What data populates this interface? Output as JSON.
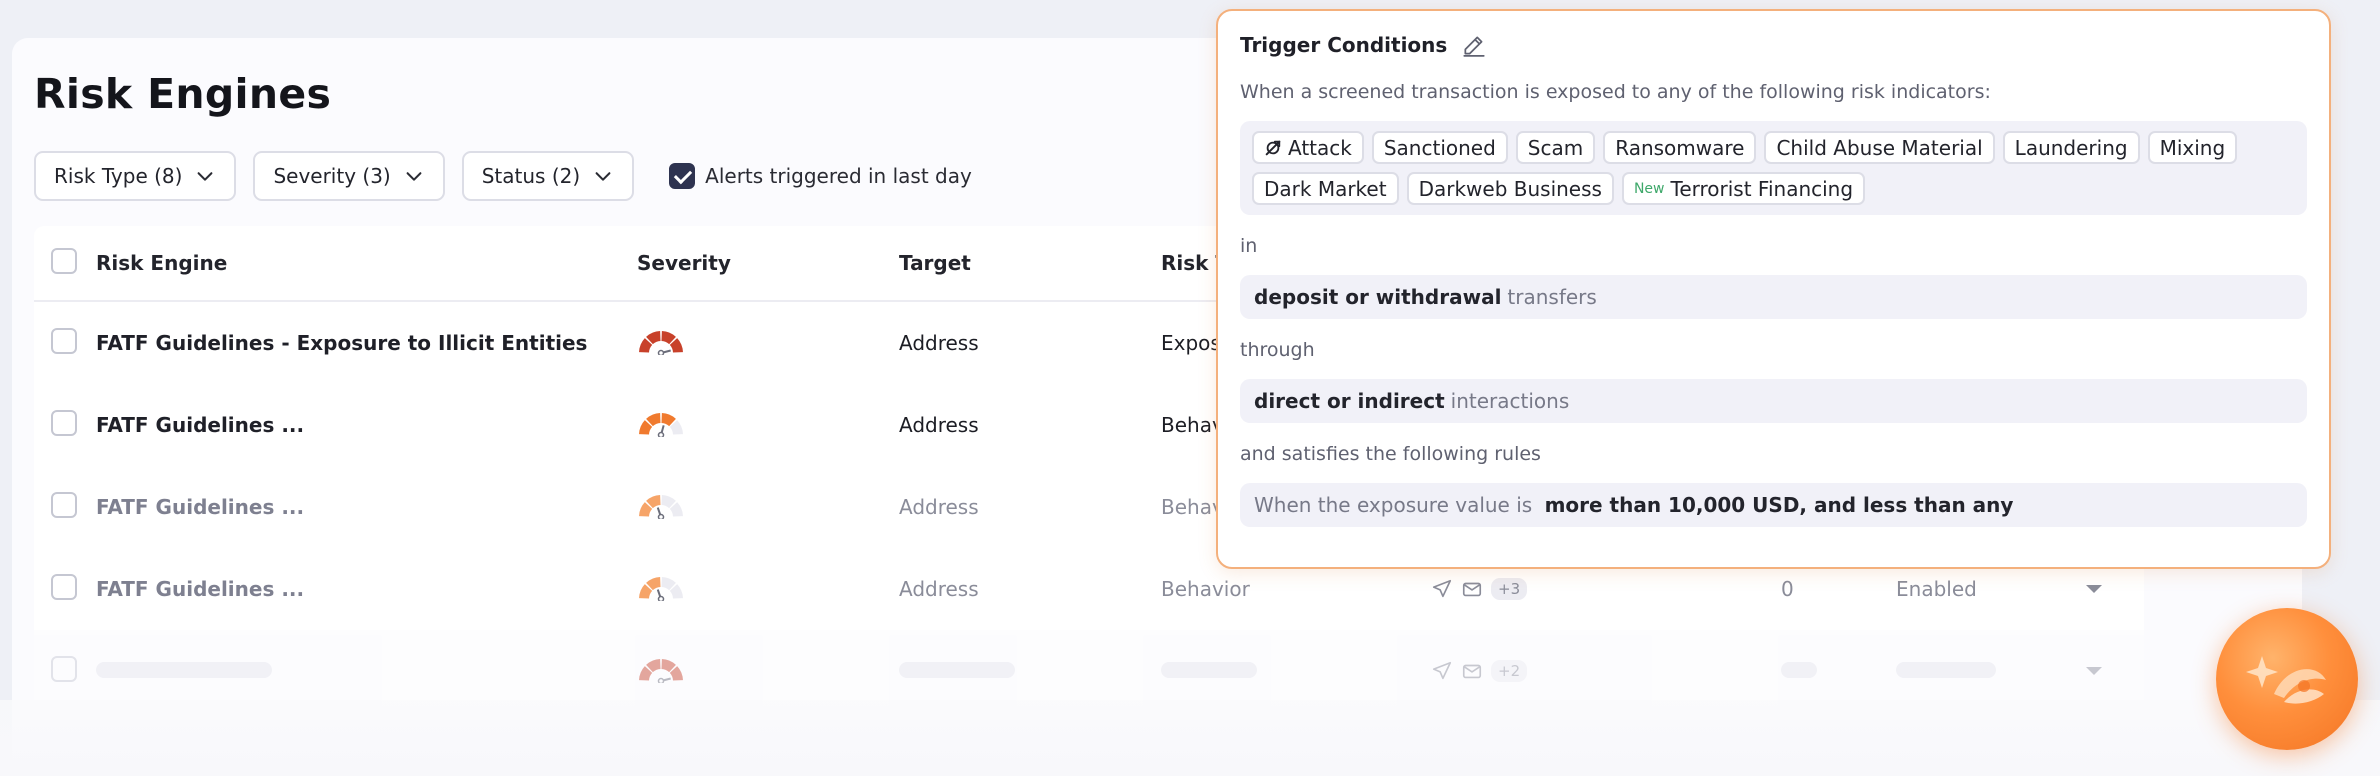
{
  "page": {
    "title": "Risk Engines"
  },
  "filters": {
    "risk_type": "Risk Type (8)",
    "severity": "Severity (3)",
    "status": "Status (2)",
    "alerts_checkbox_label": "Alerts triggered in last day",
    "alerts_checked": true
  },
  "table": {
    "headers": {
      "name": "Risk Engine",
      "severity": "Severity",
      "target": "Target",
      "risk_type": "Risk T"
    },
    "rows": [
      {
        "name": "FATF Guidelines - Exposure to Illicit Entities",
        "severity_level": "high",
        "target": "Address",
        "risk_type": "Expos"
      },
      {
        "name": "FATF Guidelines ...",
        "severity_level": "medium",
        "target": "Address",
        "risk_type": "Behav"
      },
      {
        "name": "FATF Guidelines ...",
        "severity_level": "low",
        "target": "Address",
        "risk_type": "Behav"
      },
      {
        "name": "FATF Guidelines ...",
        "severity_level": "low",
        "target": "Address",
        "risk_type": "Behavior",
        "notif_more": "+3",
        "alerts": "0",
        "status": "Enabled"
      },
      {
        "severity_level": "high",
        "notif_more": "+2"
      }
    ]
  },
  "popup": {
    "title": "Trigger Conditions",
    "intro": "When a screened transaction is exposed to any of the following risk indicators:",
    "indicators": [
      {
        "label": "Attack",
        "icon": "attack-icon"
      },
      {
        "label": "Sanctioned"
      },
      {
        "label": "Scam"
      },
      {
        "label": "Ransomware"
      },
      {
        "label": "Child Abuse Material"
      },
      {
        "label": "Laundering"
      },
      {
        "label": "Mixing"
      },
      {
        "label": "Dark Market"
      },
      {
        "label": "Darkweb Business"
      },
      {
        "label": "Terrorist Financing",
        "badge": "New"
      }
    ],
    "in_label": "in",
    "transfers_value": "deposit or withdrawal",
    "transfers_suffix": "transfers",
    "through_label": "through",
    "interactions_value": "direct or indirect",
    "interactions_suffix": "interactions",
    "rules_label": "and satisfies the following rules",
    "rule_prefix": "When the exposure value is",
    "rule_value": "more than 10,000 USD, and less than any"
  },
  "colors": {
    "accent_orange": "#f4b07c",
    "severity_high": "#c8412a",
    "severity_medium": "#f07a2e",
    "severity_low": "#f6a468"
  }
}
